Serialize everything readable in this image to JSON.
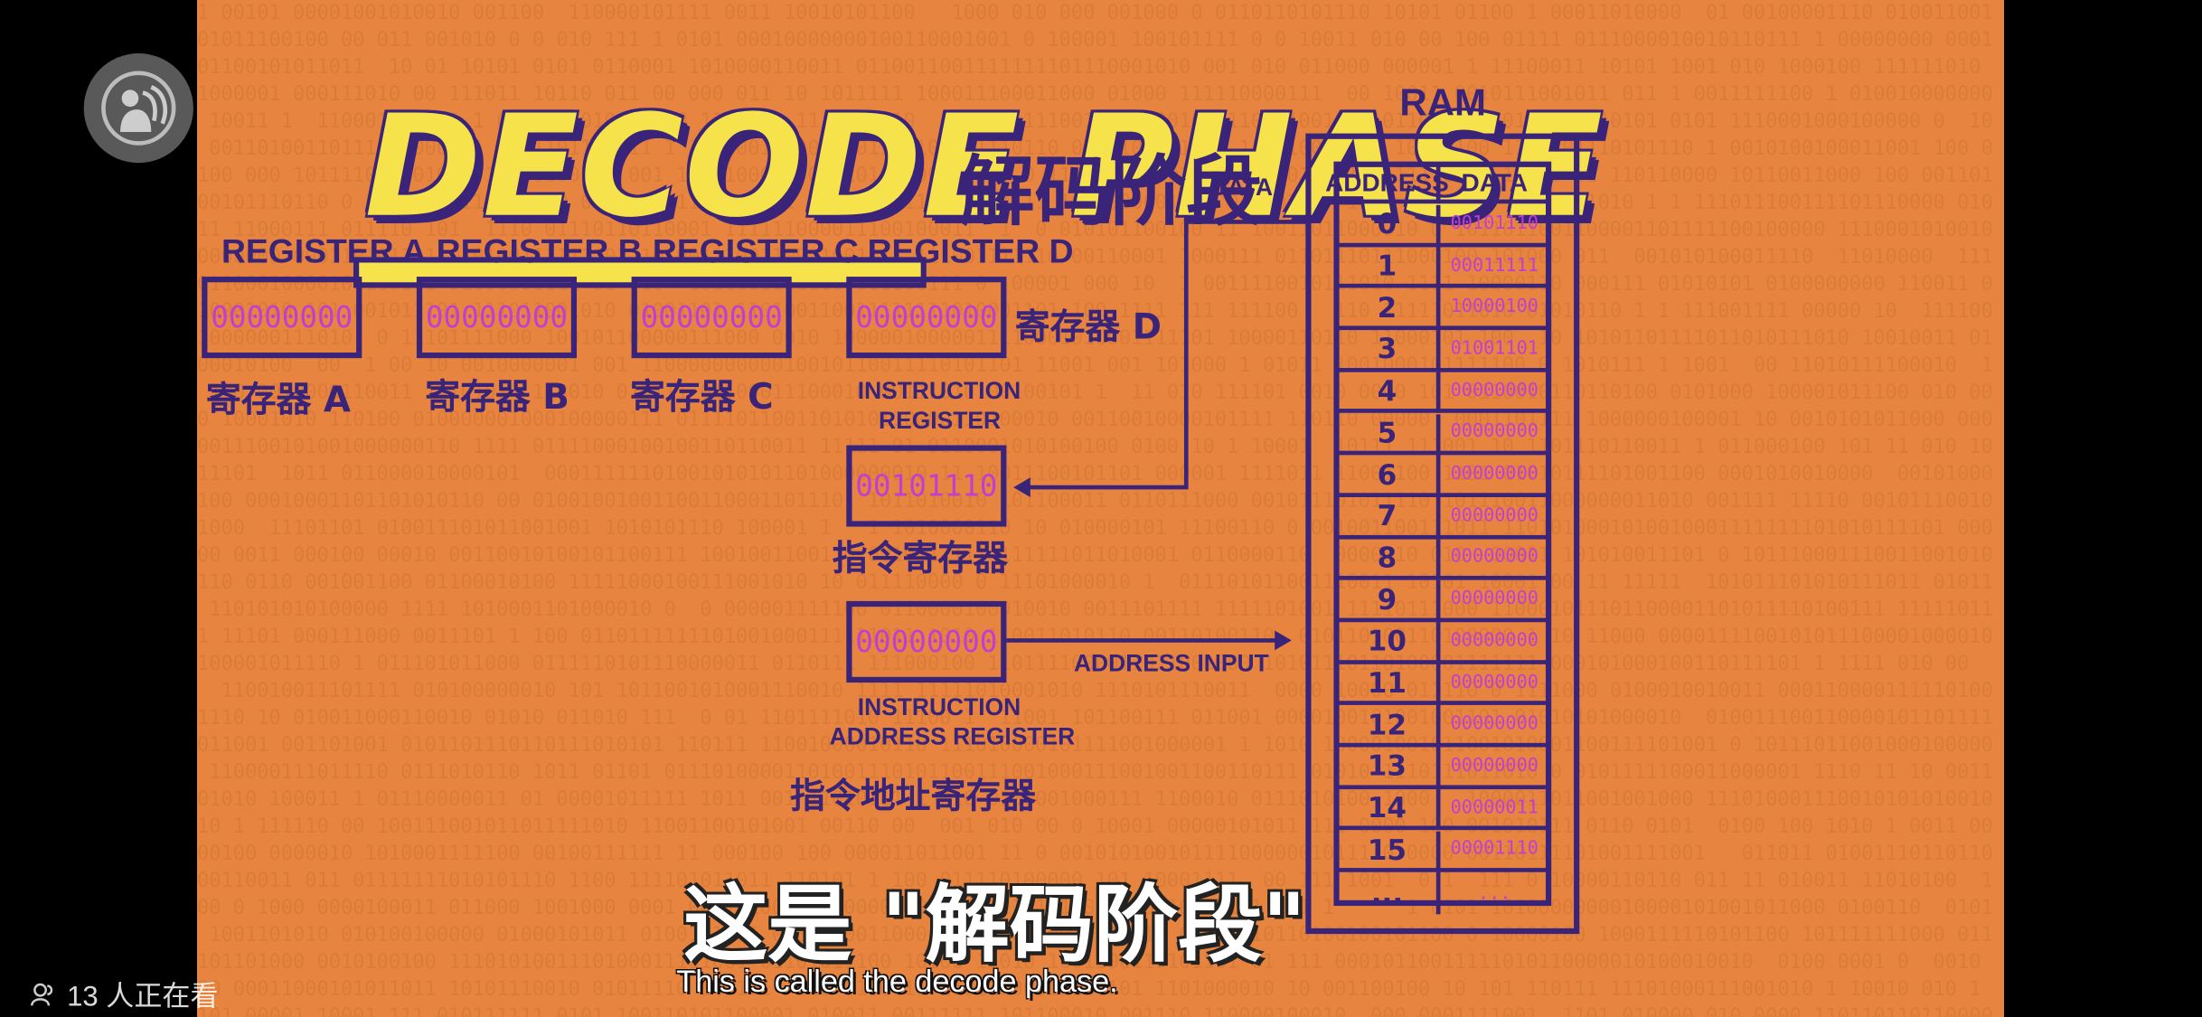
{
  "title": "DECODE PHASE",
  "title_cn": "解码阶段",
  "ram_title": "RAM",
  "data_bus_label": "DATA",
  "address_input_label": "ADDRESS INPUT",
  "registers": [
    {
      "label": "REGISTER A",
      "value": "00000000",
      "cn": "寄存器 A"
    },
    {
      "label": "REGISTER B",
      "value": "00000000",
      "cn": "寄存器 B"
    },
    {
      "label": "REGISTER C",
      "value": "00000000",
      "cn": "寄存器 C"
    },
    {
      "label": "REGISTER D",
      "value": "00000000",
      "cn": "寄存器 D"
    }
  ],
  "instruction_register": {
    "label_line1": "INSTRUCTION",
    "label_line2": "REGISTER",
    "value": "00101110",
    "cn": "指令寄存器"
  },
  "instruction_address_register": {
    "label_line1": "INSTRUCTION",
    "label_line2": "ADDRESS REGISTER",
    "value": "00000000",
    "cn": "指令地址寄存器"
  },
  "ram": {
    "headers": {
      "address": "ADDRESS",
      "data": "DATA"
    },
    "rows": [
      {
        "address": "0",
        "data": "00101110"
      },
      {
        "address": "1",
        "data": "00011111"
      },
      {
        "address": "2",
        "data": "10000100"
      },
      {
        "address": "3",
        "data": "01001101"
      },
      {
        "address": "4",
        "data": "00000000"
      },
      {
        "address": "5",
        "data": "00000000"
      },
      {
        "address": "6",
        "data": "00000000"
      },
      {
        "address": "7",
        "data": "00000000"
      },
      {
        "address": "8",
        "data": "00000000"
      },
      {
        "address": "9",
        "data": "00000000"
      },
      {
        "address": "10",
        "data": "00000000"
      },
      {
        "address": "11",
        "data": "00000000"
      },
      {
        "address": "12",
        "data": "00000000"
      },
      {
        "address": "13",
        "data": "00000000"
      },
      {
        "address": "14",
        "data": "00000011"
      },
      {
        "address": "15",
        "data": "00001110"
      },
      {
        "address": "...",
        "data": "..."
      }
    ]
  },
  "subtitle": {
    "cn": "这是 \"解码阶段\"",
    "en": "This is called the decode phase."
  },
  "viewers": "13 人正在看",
  "icons": {
    "logo": "pbs-logo-icon",
    "viewers": "viewers-icon"
  },
  "colors": {
    "background": "#E7843F",
    "ink": "#3A2479",
    "value": "#C23ED2",
    "title": "#F6E34B"
  }
}
